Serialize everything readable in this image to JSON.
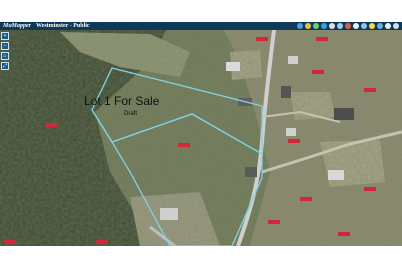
{
  "header": {
    "brand": "MuMapper",
    "title": "Westminster - Public",
    "toolbar_icons": [
      "layers-icon",
      "search-icon",
      "measure-icon",
      "globe-icon",
      "info-icon",
      "print-icon",
      "share-icon",
      "help-icon",
      "settings-icon",
      "zoom-icon",
      "home-icon",
      "menu-icon",
      "close-icon"
    ],
    "toolbar_colors": [
      "#4a9de0",
      "#e8c142",
      "#6dcf6d",
      "#3aa0d8",
      "#e0e0e0",
      "#9dd0f0",
      "#d86040",
      "#f0f0f0",
      "#8ec8ee",
      "#ffd24a",
      "#6cb0e0",
      "#f2f2f2",
      "#c9e3f5"
    ]
  },
  "map": {
    "annotation_title": "Lot 1 For Sale",
    "annotation_subtitle": "Draft",
    "parcel_outline_color": "#7fd3df",
    "road_color": "#cfcfcf",
    "parcel_tag_color": "#d3263a"
  },
  "left_tools": [
    "+",
    "−",
    "⌂",
    "⤢"
  ]
}
